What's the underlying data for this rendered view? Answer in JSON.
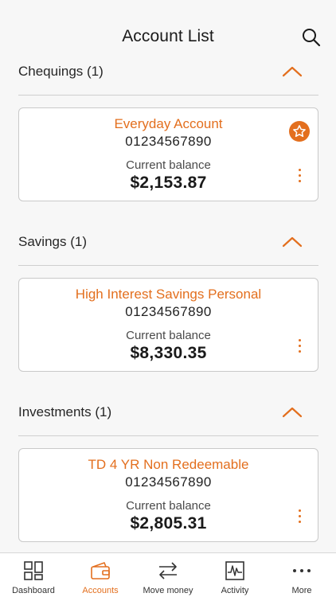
{
  "header": {
    "title": "Account List"
  },
  "colors": {
    "accent": "#e36f1e",
    "text": "#1a1a1a",
    "divider": "#cfcfcf",
    "background": "#f7f7f7"
  },
  "sections": [
    {
      "title": "Chequings (1)",
      "account": {
        "name": "Everyday Account",
        "number": "01234567890",
        "balance_label": "Current balance",
        "balance": "$2,153.87",
        "favorite": true
      }
    },
    {
      "title": "Savings (1)",
      "account": {
        "name": "High Interest Savings Personal",
        "number": "01234567890",
        "balance_label": "Current balance",
        "balance": "$8,330.35",
        "favorite": false
      }
    },
    {
      "title": "Investments (1)",
      "account": {
        "name": "TD 4 YR Non Redeemable",
        "number": "01234567890",
        "balance_label": "Current balance",
        "balance": "$2,805.31",
        "favorite": false
      }
    }
  ],
  "tabbar": {
    "active": "Accounts",
    "items": [
      {
        "label": "Dashboard",
        "icon": "dashboard-icon"
      },
      {
        "label": "Accounts",
        "icon": "wallet-icon"
      },
      {
        "label": "Move money",
        "icon": "transfer-arrows-icon"
      },
      {
        "label": "Activity",
        "icon": "activity-chart-icon"
      },
      {
        "label": "More",
        "icon": "more-dots-icon"
      }
    ]
  }
}
